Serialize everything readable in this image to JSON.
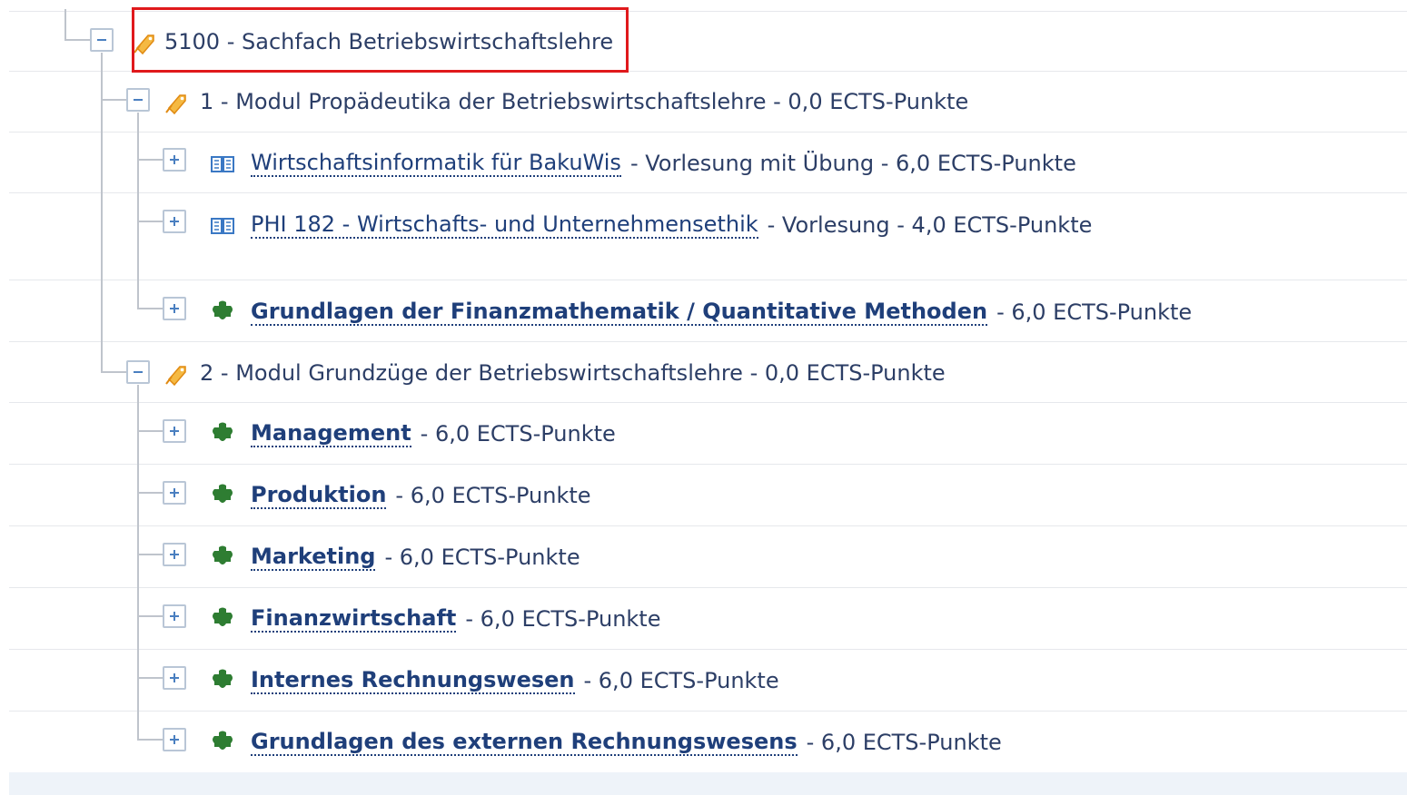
{
  "root": {
    "label": "5100 - Sachfach Betriebswirtschaftslehre",
    "icon": "pencil-tag-icon"
  },
  "module1": {
    "label": "1 - Modul Propädeutika der Betriebswirtschaftslehre - 0,0 ECTS-Punkte",
    "icon": "pencil-tag-icon"
  },
  "module1_items": [
    {
      "title": "Wirtschaftsinformatik für BakuWis",
      "suffix": "- Vorlesung mit Übung - 6,0 ECTS-Punkte",
      "icon": "book-icon"
    },
    {
      "title": "PHI 182 - Wirtschafts- und Unternehmensethik",
      "suffix": "- Vorlesung - 4,0 ECTS-Punkte",
      "icon": "book-icon"
    },
    {
      "title": "Grundlagen der Finanzmathematik / Quantitative Methoden",
      "suffix": "- 6,0 ECTS-Punkte",
      "icon": "puzzle-icon"
    }
  ],
  "module2": {
    "label": "2 - Modul Grundzüge der Betriebswirtschaftslehre - 0,0 ECTS-Punkte",
    "icon": "pencil-tag-icon"
  },
  "module2_items": [
    {
      "title": "Management",
      "suffix": "- 6,0 ECTS-Punkte",
      "icon": "puzzle-icon"
    },
    {
      "title": "Produktion",
      "suffix": "- 6,0 ECTS-Punkte",
      "icon": "puzzle-icon"
    },
    {
      "title": "Marketing",
      "suffix": "- 6,0 ECTS-Punkte",
      "icon": "puzzle-icon"
    },
    {
      "title": "Finanzwirtschaft",
      "suffix": "- 6,0 ECTS-Punkte",
      "icon": "puzzle-icon"
    },
    {
      "title": "Internes Rechnungswesen",
      "suffix": "- 6,0 ECTS-Punkte",
      "icon": "puzzle-icon"
    },
    {
      "title": "Grundlagen des externen Rechnungswesens",
      "suffix": "- 6,0 ECTS-Punkte",
      "icon": "puzzle-icon"
    }
  ],
  "colors": {
    "link": "#1f3f7a",
    "highlight": "#e0191c",
    "puzzle": "#2e7d32",
    "tag": "#f5a623",
    "book": "#3a78c4"
  }
}
